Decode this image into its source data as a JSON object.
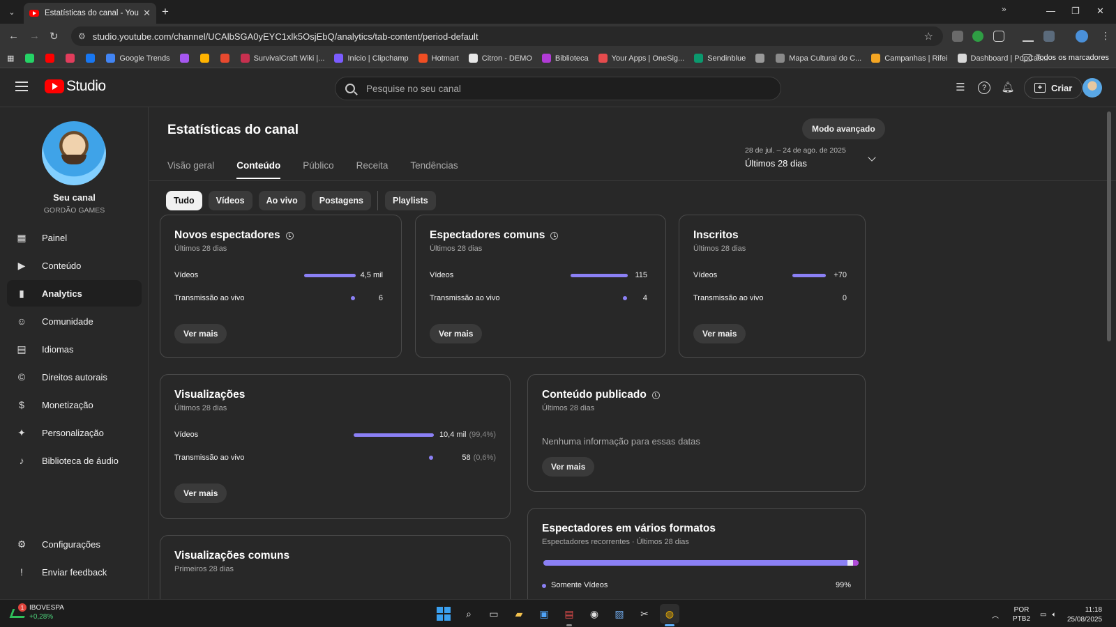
{
  "browser": {
    "tab_title": "Estatísticas do canal - YouTube",
    "url": "studio.youtube.com/channel/UCAlbSGA0yEYC1xlk5OsjEbQ/analytics/tab-content/period-default",
    "bookmarks": [
      {
        "label": "",
        "color": "#25d366"
      },
      {
        "label": "",
        "color": "#ff0000"
      },
      {
        "label": "",
        "color": "#e23d5c"
      },
      {
        "label": "",
        "color": "#1877f2"
      },
      {
        "label": "Google Trends",
        "color": "#4285f4"
      },
      {
        "label": "",
        "color": "#a657f0"
      },
      {
        "label": "",
        "color": "#ffb300"
      },
      {
        "label": "",
        "color": "#e8492f"
      },
      {
        "label": "SurvivalCraft Wiki |...",
        "color": "#c7304f"
      },
      {
        "label": "Início | Clipchamp",
        "color": "#7b5cff"
      },
      {
        "label": "Hotmart",
        "color": "#f04e23"
      },
      {
        "label": "Citron - DEMO",
        "color": "#e8e8e8"
      },
      {
        "label": "Biblioteca",
        "color": "#b13bd6"
      },
      {
        "label": "Your Apps | OneSig...",
        "color": "#e54b4d"
      },
      {
        "label": "Sendinblue",
        "color": "#0b996e"
      },
      {
        "label": "",
        "color": "#999999"
      },
      {
        "label": "Mapa Cultural do C...",
        "color": "#8a8a8a"
      },
      {
        "label": "Campanhas | Rifei",
        "color": "#f5a623"
      },
      {
        "label": "Dashboard | PopCas...",
        "color": "#d8d8d8"
      }
    ],
    "bookmarks_all": "Todos os marcadores"
  },
  "header": {
    "logo_text": "Studio",
    "search_placeholder": "Pesquise no seu canal",
    "create_label": "Criar"
  },
  "sidebar": {
    "channel_name": "Seu canal",
    "channel_handle": "GORDÃO GAMES",
    "items": [
      {
        "label": "Painel",
        "icon": "dashboard-icon"
      },
      {
        "label": "Conteúdo",
        "icon": "content-icon"
      },
      {
        "label": "Analytics",
        "icon": "analytics-icon"
      },
      {
        "label": "Comunidade",
        "icon": "community-icon"
      },
      {
        "label": "Idiomas",
        "icon": "subtitles-icon"
      },
      {
        "label": "Direitos autorais",
        "icon": "copyright-icon"
      },
      {
        "label": "Monetização",
        "icon": "dollar-icon"
      },
      {
        "label": "Personalização",
        "icon": "magic-wand-icon"
      },
      {
        "label": "Biblioteca de áudio",
        "icon": "audio-library-icon"
      }
    ],
    "bottom_items": [
      {
        "label": "Configurações",
        "icon": "gear-icon"
      },
      {
        "label": "Enviar feedback",
        "icon": "feedback-icon"
      }
    ]
  },
  "main": {
    "title": "Estatísticas do canal",
    "advanced_mode": "Modo avançado",
    "tabs": [
      "Visão geral",
      "Conteúdo",
      "Público",
      "Receita",
      "Tendências"
    ],
    "active_tab": "Conteúdo",
    "period_range": "28 de jul. – 24 de ago. de 2025",
    "period_label": "Últimos 28 dias",
    "chips": [
      "Tudo",
      "Vídeos",
      "Ao vivo",
      "Postagens"
    ],
    "chip_playlists": "Playlists",
    "see_more": "Ver mais",
    "cards": {
      "new_viewers": {
        "title": "Novos espectadores",
        "subtitle": "Últimos 28 dias",
        "rows": [
          {
            "label": "Vídeos",
            "value": "4,5 mil"
          },
          {
            "label": "Transmissão ao vivo",
            "value": "6"
          }
        ]
      },
      "common_viewers": {
        "title": "Espectadores comuns",
        "subtitle": "Últimos 28 dias",
        "rows": [
          {
            "label": "Vídeos",
            "value": "115"
          },
          {
            "label": "Transmissão ao vivo",
            "value": "4"
          }
        ]
      },
      "subscribers": {
        "title": "Inscritos",
        "subtitle": "Últimos 28 dias",
        "rows": [
          {
            "label": "Vídeos",
            "value": "+70"
          },
          {
            "label": "Transmissão ao vivo",
            "value": "0"
          }
        ]
      },
      "views": {
        "title": "Visualizações",
        "subtitle": "Últimos 28 dias",
        "rows": [
          {
            "label": "Vídeos",
            "value": "10,4 mil",
            "pct": "(99,4%)"
          },
          {
            "label": "Transmissão ao vivo",
            "value": "58",
            "pct": "(0,6%)"
          }
        ]
      },
      "published": {
        "title": "Conteúdo publicado",
        "subtitle": "Últimos 28 dias",
        "empty": "Nenhuma informação para essas datas"
      },
      "common_views": {
        "title": "Visualizações comuns",
        "subtitle": "Primeiros 28 dias"
      },
      "multi_format": {
        "title": "Espectadores em vários formatos",
        "subtitle": "Espectadores recorrentes · Últimos 28 dias",
        "legend_label": "Somente Vídeos",
        "legend_value": "99%"
      }
    }
  },
  "taskbar": {
    "stock_name": "IBOVESPA",
    "stock_change": "+0,28%",
    "stock_badge": "1",
    "lang": "POR",
    "layout": "PTB2",
    "time": "11:18",
    "date": "25/08/2025"
  }
}
